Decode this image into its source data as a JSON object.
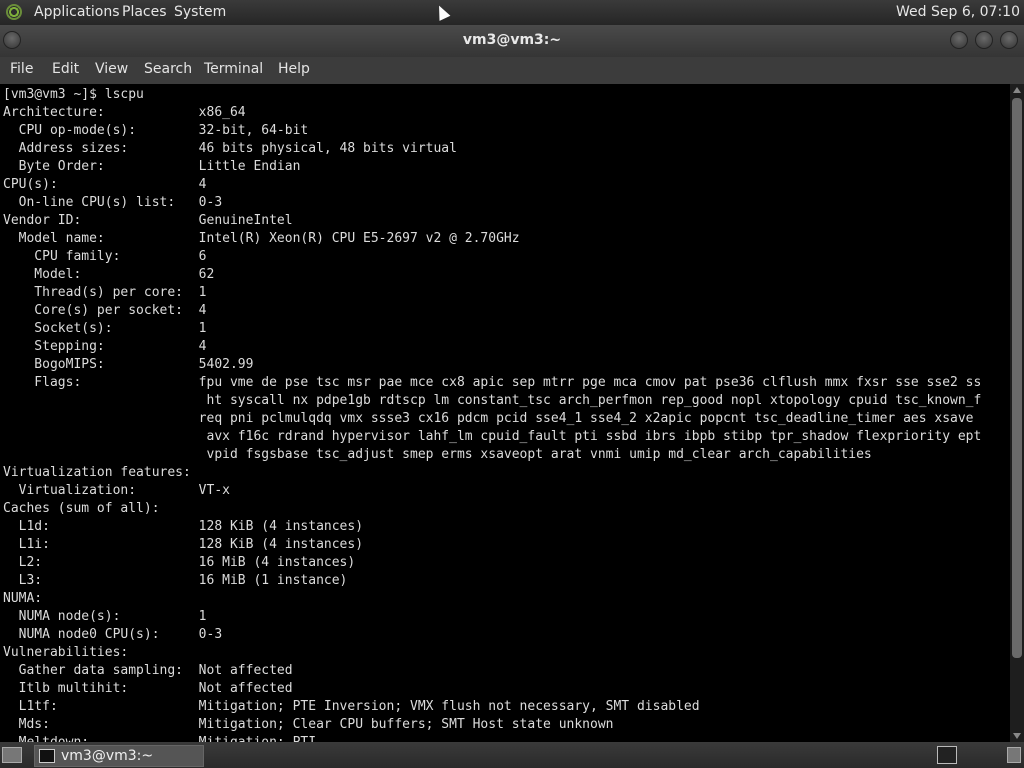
{
  "top_panel": {
    "menus": [
      "Applications",
      "Places",
      "System"
    ],
    "clock": "Wed Sep  6, 07:10"
  },
  "window": {
    "title": "vm3@vm3:~",
    "menus": [
      "File",
      "Edit",
      "View",
      "Search",
      "Terminal",
      "Help"
    ]
  },
  "terminal": {
    "lines": [
      "[vm3@vm3 ~]$ lscpu",
      "Architecture:            x86_64",
      "  CPU op-mode(s):        32-bit, 64-bit",
      "  Address sizes:         46 bits physical, 48 bits virtual",
      "  Byte Order:            Little Endian",
      "CPU(s):                  4",
      "  On-line CPU(s) list:   0-3",
      "Vendor ID:               GenuineIntel",
      "  Model name:            Intel(R) Xeon(R) CPU E5-2697 v2 @ 2.70GHz",
      "    CPU family:          6",
      "    Model:               62",
      "    Thread(s) per core:  1",
      "    Core(s) per socket:  4",
      "    Socket(s):           1",
      "    Stepping:            4",
      "    BogoMIPS:            5402.99",
      "    Flags:               fpu vme de pse tsc msr pae mce cx8 apic sep mtrr pge mca cmov pat pse36 clflush mmx fxsr sse sse2 ss",
      "                          ht syscall nx pdpe1gb rdtscp lm constant_tsc arch_perfmon rep_good nopl xtopology cpuid tsc_known_f",
      "                         req pni pclmulqdq vmx ssse3 cx16 pdcm pcid sse4_1 sse4_2 x2apic popcnt tsc_deadline_timer aes xsave",
      "                          avx f16c rdrand hypervisor lahf_lm cpuid_fault pti ssbd ibrs ibpb stibp tpr_shadow flexpriority ept",
      "                          vpid fsgsbase tsc_adjust smep erms xsaveopt arat vnmi umip md_clear arch_capabilities",
      "Virtualization features:",
      "  Virtualization:        VT-x",
      "Caches (sum of all):",
      "  L1d:                   128 KiB (4 instances)",
      "  L1i:                   128 KiB (4 instances)",
      "  L2:                    16 MiB (4 instances)",
      "  L3:                    16 MiB (1 instance)",
      "NUMA:",
      "  NUMA node(s):          1",
      "  NUMA node0 CPU(s):     0-3",
      "Vulnerabilities:",
      "  Gather data sampling:  Not affected",
      "  Itlb multihit:         Not affected",
      "  L1tf:                  Mitigation; PTE Inversion; VMX flush not necessary, SMT disabled",
      "  Mds:                   Mitigation; Clear CPU buffers; SMT Host state unknown",
      "  Meltdown:              Mitigation; PTI"
    ]
  },
  "taskbar": {
    "task_label": "vm3@vm3:~"
  }
}
